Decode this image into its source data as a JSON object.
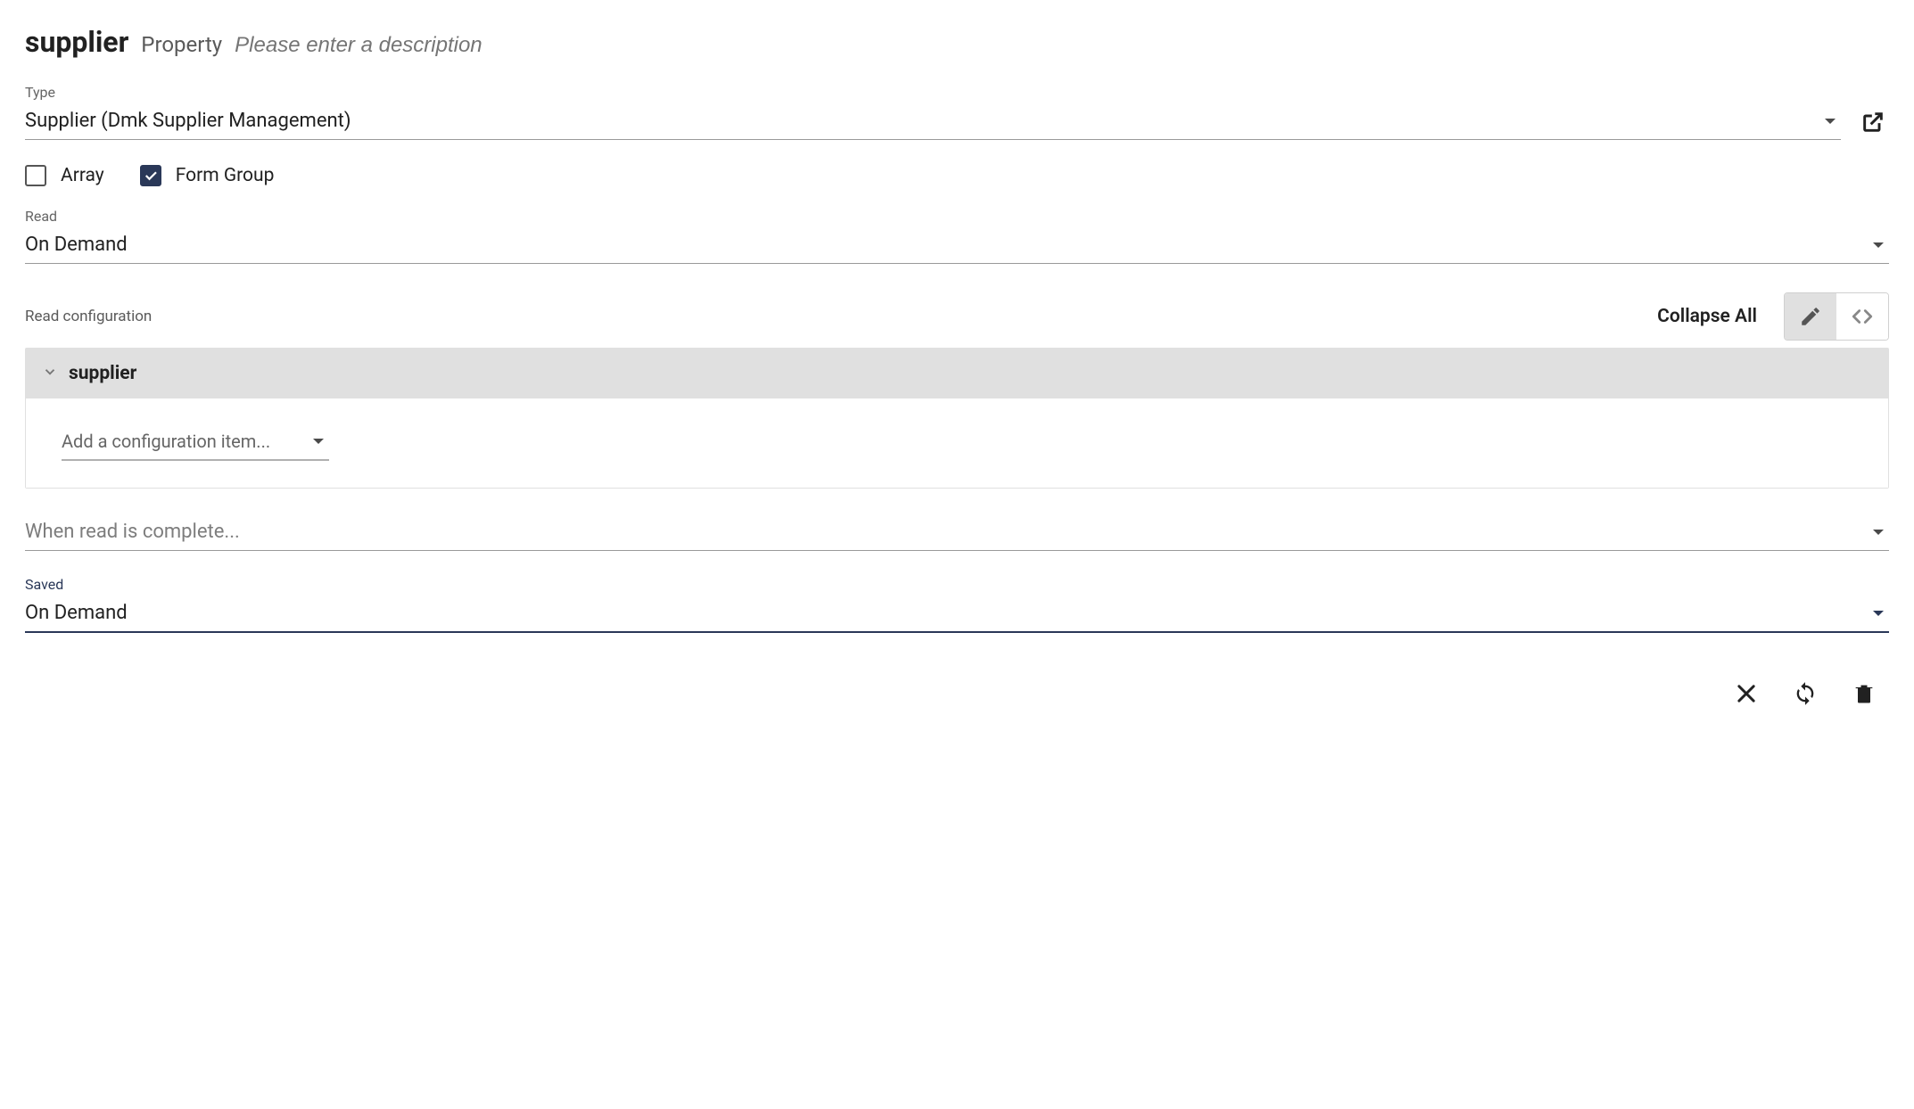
{
  "header": {
    "title": "supplier",
    "subtitle": "Property",
    "description_placeholder": "Please enter a description"
  },
  "type": {
    "label": "Type",
    "value": "Supplier (Dmk Supplier Management)"
  },
  "checkboxes": {
    "array": {
      "label": "Array",
      "checked": false
    },
    "form_group": {
      "label": "Form Group",
      "checked": true
    }
  },
  "read": {
    "label": "Read",
    "value": "On Demand"
  },
  "read_config": {
    "label": "Read configuration",
    "collapse_all": "Collapse All",
    "panel_title": "supplier",
    "add_item_placeholder": "Add a configuration item..."
  },
  "when_complete": {
    "placeholder": "When read is complete..."
  },
  "saved": {
    "label": "Saved",
    "value": "On Demand"
  },
  "colors": {
    "accent": "#2A3858"
  }
}
